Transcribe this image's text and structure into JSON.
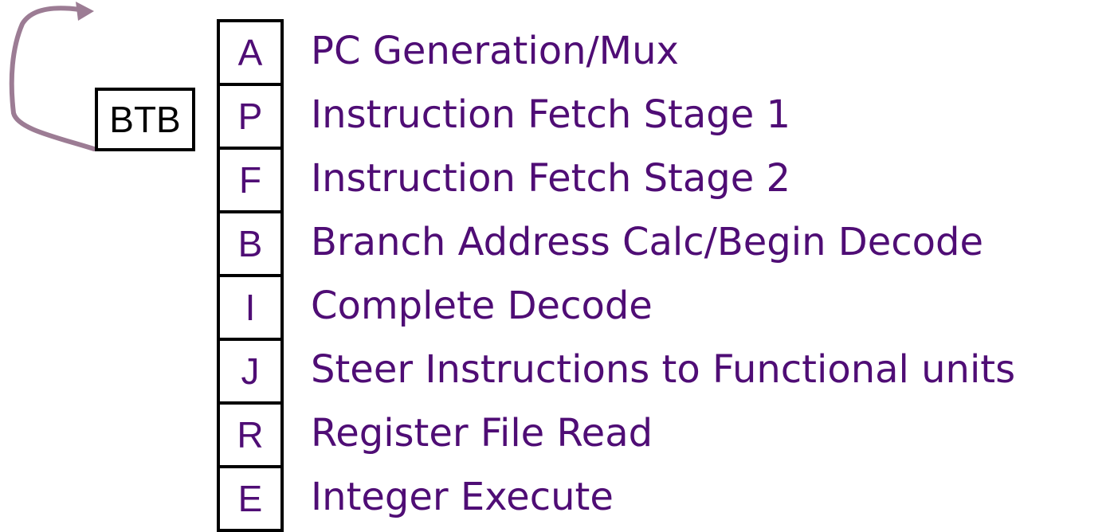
{
  "colors": {
    "accent": "#4f0d75",
    "arrow": "#9c7c94",
    "border": "#000000"
  },
  "btb": {
    "label": "BTB"
  },
  "stages": [
    {
      "letter": "A",
      "description": "PC Generation/Mux"
    },
    {
      "letter": "P",
      "description": "Instruction Fetch Stage 1"
    },
    {
      "letter": "F",
      "description": "Instruction Fetch Stage 2"
    },
    {
      "letter": "B",
      "description": "Branch Address Calc/Begin Decode"
    },
    {
      "letter": "I",
      "description": "Complete Decode"
    },
    {
      "letter": "J",
      "description": "Steer Instructions to Functional units"
    },
    {
      "letter": "R",
      "description": "Register File Read"
    },
    {
      "letter": "E",
      "description": "Integer Execute"
    }
  ]
}
